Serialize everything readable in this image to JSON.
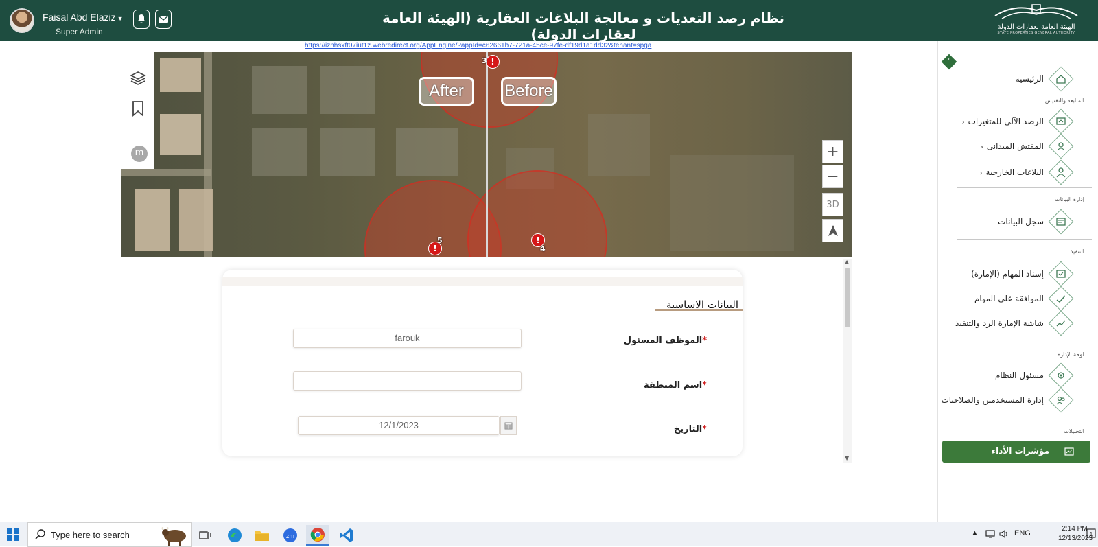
{
  "header": {
    "user_name": "Faisal Abd Elaziz",
    "user_role": "Super Admin",
    "title": "نظام رصد التعديات و معالجة البلاغات العقارية (الهيئة العامة لعقارات الدولة)",
    "logo_ar": "الهيئة العامة لعقارات الدولة",
    "logo_en": "STATE PROPERTIES GENERAL AUTHORITY",
    "icons": [
      "bell-icon",
      "mail-icon"
    ]
  },
  "url": "https://iznhsxft07iut1z.webredirect.org/AppEngine/?appId=c62661b7-721a-45ce-97fe-df19d1a1dd32&tenant=spga",
  "map": {
    "after_label": "After",
    "before_label": "Before",
    "avatar_letter": "m",
    "markers": [
      "3",
      "5",
      "4"
    ],
    "controls": {
      "zoom_in": "+",
      "zoom_out": "−",
      "three_d": "3D"
    }
  },
  "form": {
    "section_title": "البيانات الاساسية",
    "fields": [
      {
        "label": "الموظف المسئول",
        "value": "farouk",
        "required": "*"
      },
      {
        "label": "اسم المنطقة",
        "value": "",
        "required": "*"
      },
      {
        "label": "التاريخ",
        "value": "12/1/2023",
        "required": "*"
      }
    ]
  },
  "sidebar": {
    "items": [
      {
        "label": "الرئيسية",
        "icon": "home-icon"
      },
      {
        "section": "المتابعة والتفتيش"
      },
      {
        "label": "الرصد الآلى للمتغيرات",
        "chevron": "‹",
        "icon": "monitor-icon"
      },
      {
        "label": "المفتش الميدانى",
        "chevron": "‹",
        "icon": "inspector-icon"
      },
      {
        "label": "البلاغات الخارجية",
        "chevron": "‹",
        "icon": "user-icon"
      },
      {
        "section": "إدارة البيانات"
      },
      {
        "label": "سجل البيانات",
        "icon": "records-icon"
      },
      {
        "section": "التنفيذ"
      },
      {
        "label": "إسناد المهام (الإمارة)",
        "icon": "assign-icon"
      },
      {
        "label": "الموافقة على المهام",
        "icon": "approve-icon"
      },
      {
        "label": "شاشة الإمارة الرد والتنفيذ",
        "icon": "response-icon"
      },
      {
        "section": "لوحة الإدارة"
      },
      {
        "label": "مسئول النظام",
        "icon": "admin-icon"
      },
      {
        "label": "إدارة المستخدمين والصلاحيات",
        "icon": "users-icon"
      },
      {
        "section": "التحليلات"
      }
    ],
    "kpi_button": "مؤشرات الأداء"
  },
  "taskbar": {
    "search_placeholder": "Type here to search",
    "language": "ENG",
    "time": "2:14 PM",
    "date": "12/13/2023",
    "notifications": "1"
  },
  "colors": {
    "header_bg": "#1e4d40",
    "accent_green": "#3c7a3a",
    "required": "#d02020"
  }
}
